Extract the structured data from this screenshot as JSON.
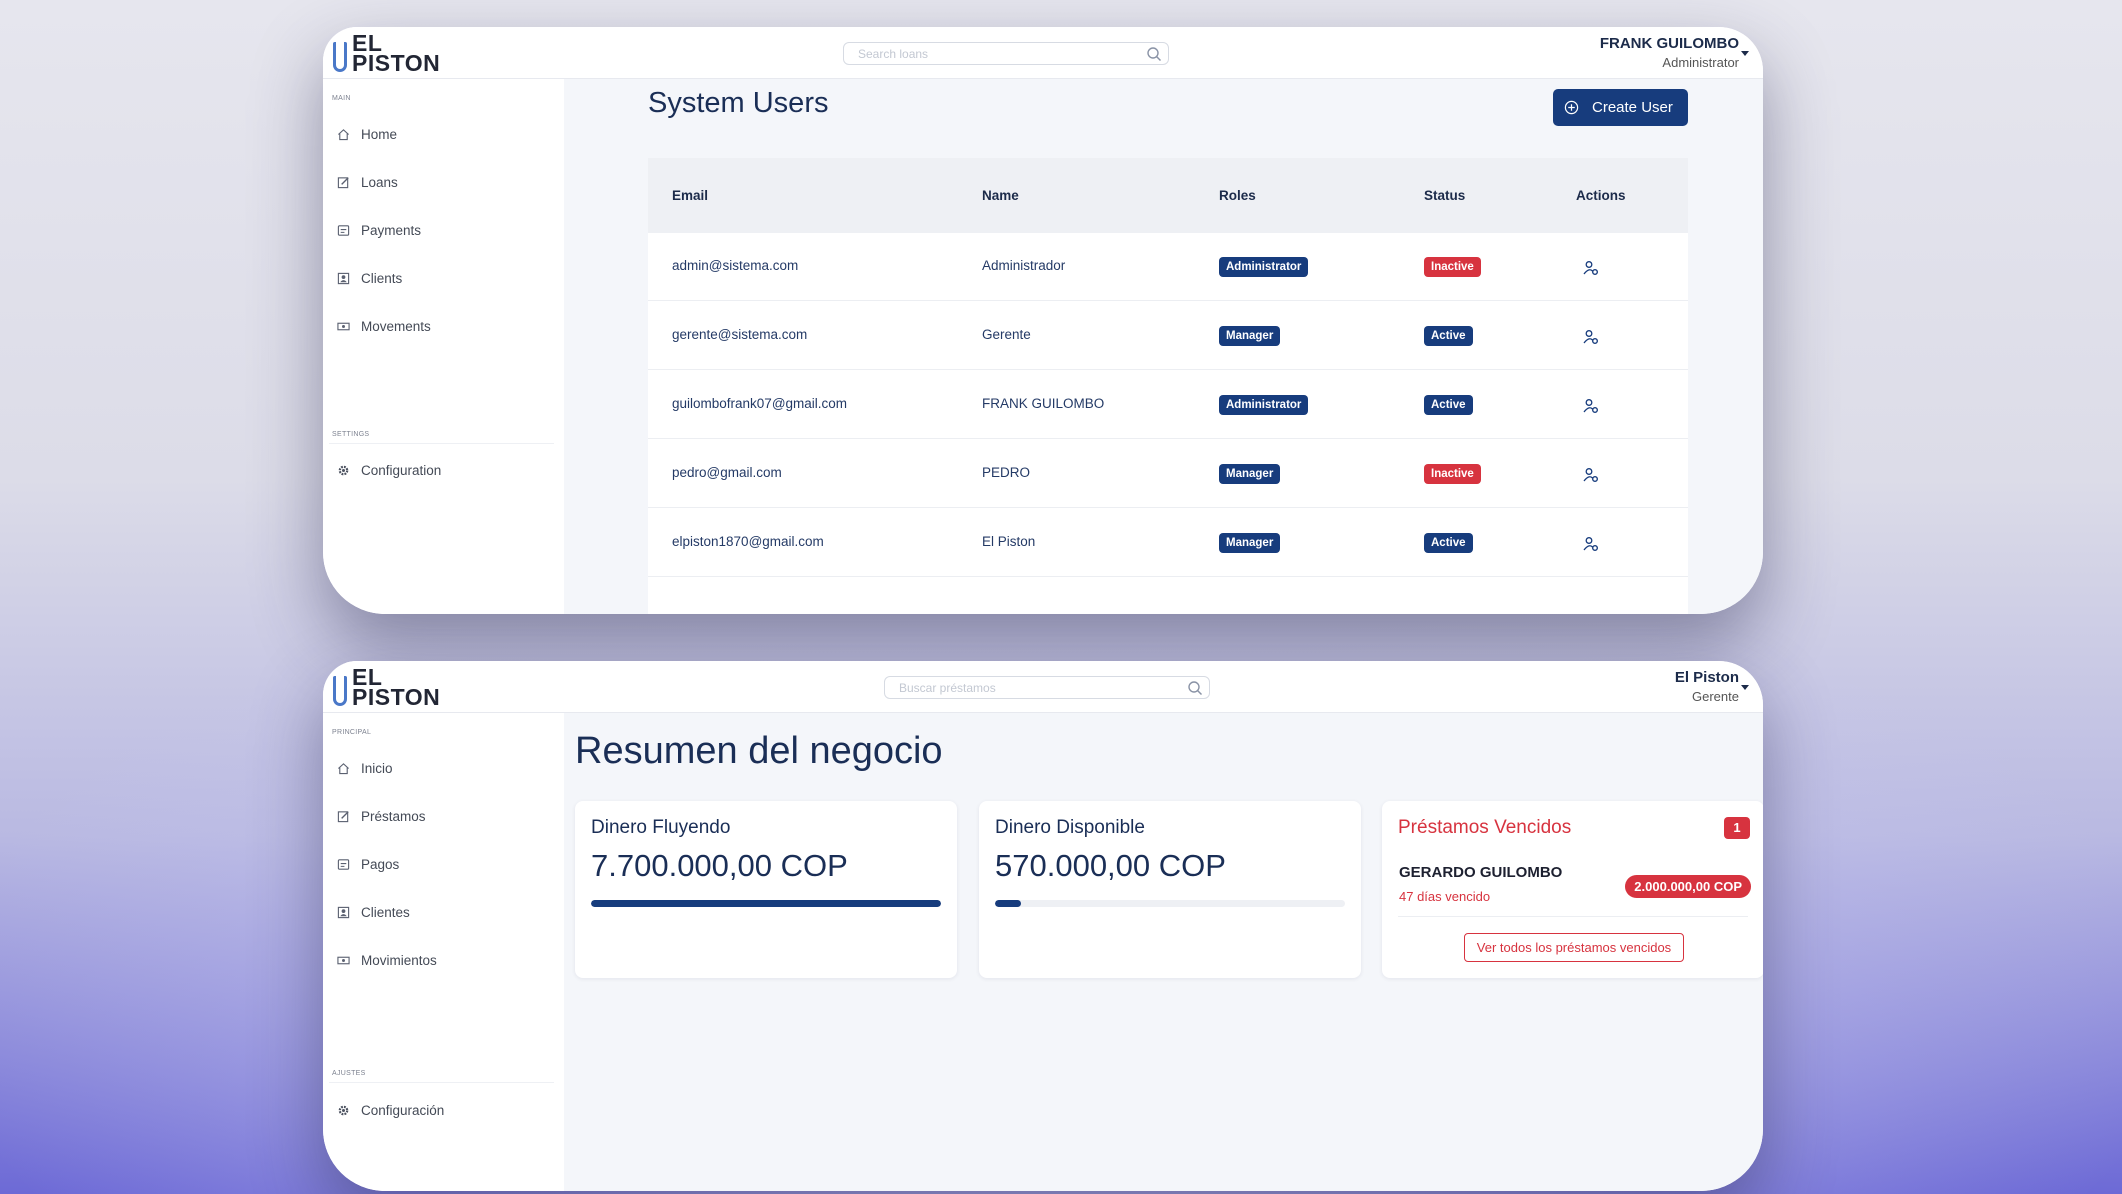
{
  "colors": {
    "primary": "#173c7d",
    "danger": "#d7333f",
    "text": "#1a2e56",
    "bg": "#f4f6fa"
  },
  "screen1": {
    "logo": {
      "line1": "EL",
      "line2": "PISTON"
    },
    "search_placeholder": "Search loans",
    "user": {
      "name": "FRANK GUILOMBO",
      "role": "Administrator"
    },
    "sidebar": {
      "main_label": "MAIN",
      "items": [
        {
          "label": "Home",
          "icon": "home-icon"
        },
        {
          "label": "Loans",
          "icon": "edit-icon"
        },
        {
          "label": "Payments",
          "icon": "payments-icon"
        },
        {
          "label": "Clients",
          "icon": "clients-icon"
        },
        {
          "label": "Movements",
          "icon": "movements-icon"
        }
      ],
      "settings_label": "SETTINGS",
      "config_label": "Configuration"
    },
    "page_title": "System Users",
    "create_button": "Create User",
    "table": {
      "headers": [
        "Email",
        "Name",
        "Roles",
        "Status",
        "Actions"
      ],
      "rows": [
        {
          "email": "admin@sistema.com",
          "name": "Administrador",
          "role": "Administrator",
          "status": "Inactive"
        },
        {
          "email": "gerente@sistema.com",
          "name": "Gerente",
          "role": "Manager",
          "status": "Active"
        },
        {
          "email": "guilombofrank07@gmail.com",
          "name": "FRANK GUILOMBO",
          "role": "Administrator",
          "status": "Active"
        },
        {
          "email": "pedro@gmail.com",
          "name": "PEDRO",
          "role": "Manager",
          "status": "Inactive"
        },
        {
          "email": "elpiston1870@gmail.com",
          "name": "El Piston",
          "role": "Manager",
          "status": "Active"
        }
      ]
    }
  },
  "screen2": {
    "logo": {
      "line1": "EL",
      "line2": "PISTON"
    },
    "search_placeholder": "Buscar préstamos",
    "user": {
      "name": "El Piston",
      "role": "Gerente"
    },
    "sidebar": {
      "main_label": "PRINCIPAL",
      "items": [
        {
          "label": "Inicio",
          "icon": "home-icon"
        },
        {
          "label": "Préstamos",
          "icon": "edit-icon"
        },
        {
          "label": "Pagos",
          "icon": "payments-icon"
        },
        {
          "label": "Clientes",
          "icon": "clients-icon"
        },
        {
          "label": "Movimientos",
          "icon": "movements-icon"
        }
      ],
      "settings_label": "AJUSTES",
      "config_label": "Configuración"
    },
    "page_title": "Resumen del negocio",
    "cards": {
      "flowing": {
        "title": "Dinero Fluyendo",
        "value": "7.700.000,00 COP",
        "progress": 1.0
      },
      "available": {
        "title": "Dinero Disponible",
        "value": "570.000,00 COP",
        "progress": 0.074
      },
      "overdue": {
        "title": "Préstamos Vencidos",
        "count": "1",
        "debtor": "GERARDO GUILOMBO",
        "days": "47 días vencido",
        "amount": "2.000.000,00 COP",
        "button": "Ver todos los préstamos vencidos"
      }
    }
  }
}
